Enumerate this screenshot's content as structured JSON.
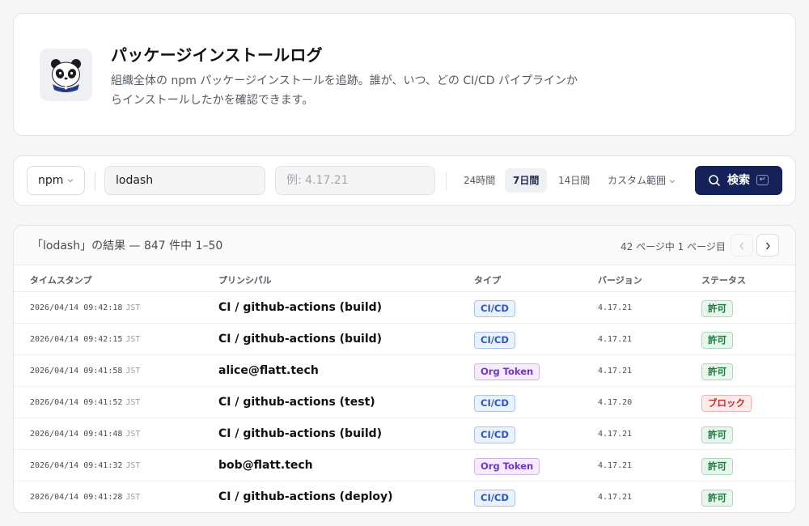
{
  "header": {
    "title": "パッケージインストールログ",
    "description": "組織全体の npm パッケージインストールを追跡。誰が、いつ、どの CI/CD パイプラインからインストールしたかを確認できます。",
    "logo_icon": "panda-mascot-icon"
  },
  "search": {
    "ecosystem": "npm",
    "package_value": "lodash",
    "version_placeholder": "例: 4.17.21",
    "ranges": [
      {
        "label": "24時間",
        "active": false
      },
      {
        "label": "7日間",
        "active": true
      },
      {
        "label": "14日間",
        "active": false
      },
      {
        "label": "カスタム範囲",
        "active": false
      }
    ],
    "search_label": "検索",
    "enter_key": "↵"
  },
  "results": {
    "summary": "「lodash」の結果 — 847 件中 1–50",
    "page_info": "42 ページ中 1 ページ目",
    "columns": {
      "timestamp": "タイムスタンプ",
      "principal": "プリンシパル",
      "type": "タイプ",
      "version": "バージョン",
      "status": "ステータス"
    },
    "rows": [
      {
        "timestamp": "2026/04/14 09:42:18",
        "tz": "JST",
        "principal": "CI / github-actions (build)",
        "type": "CI/CD",
        "type_kind": "cicd",
        "version": "4.17.21",
        "status": "許可",
        "status_kind": "ok"
      },
      {
        "timestamp": "2026/04/14 09:42:15",
        "tz": "JST",
        "principal": "CI / github-actions (build)",
        "type": "CI/CD",
        "type_kind": "cicd",
        "version": "4.17.21",
        "status": "許可",
        "status_kind": "ok"
      },
      {
        "timestamp": "2026/04/14 09:41:58",
        "tz": "JST",
        "principal": "alice@flatt.tech",
        "type": "Org Token",
        "type_kind": "token",
        "version": "4.17.21",
        "status": "許可",
        "status_kind": "ok"
      },
      {
        "timestamp": "2026/04/14 09:41:52",
        "tz": "JST",
        "principal": "CI / github-actions (test)",
        "type": "CI/CD",
        "type_kind": "cicd",
        "version": "4.17.20",
        "status": "ブロック",
        "status_kind": "ng"
      },
      {
        "timestamp": "2026/04/14 09:41:48",
        "tz": "JST",
        "principal": "CI / github-actions (build)",
        "type": "CI/CD",
        "type_kind": "cicd",
        "version": "4.17.21",
        "status": "許可",
        "status_kind": "ok"
      },
      {
        "timestamp": "2026/04/14 09:41:32",
        "tz": "JST",
        "principal": "bob@flatt.tech",
        "type": "Org Token",
        "type_kind": "token",
        "version": "4.17.21",
        "status": "許可",
        "status_kind": "ok"
      },
      {
        "timestamp": "2026/04/14 09:41:28",
        "tz": "JST",
        "principal": "CI / github-actions (deploy)",
        "type": "CI/CD",
        "type_kind": "cicd",
        "version": "4.17.21",
        "status": "許可",
        "status_kind": "ok"
      }
    ]
  },
  "colors": {
    "primary": "#152259",
    "cicd": "#2c56c9",
    "org_token": "#7335c4",
    "allowed": "#1a7a3e",
    "blocked": "#c72a2a"
  }
}
